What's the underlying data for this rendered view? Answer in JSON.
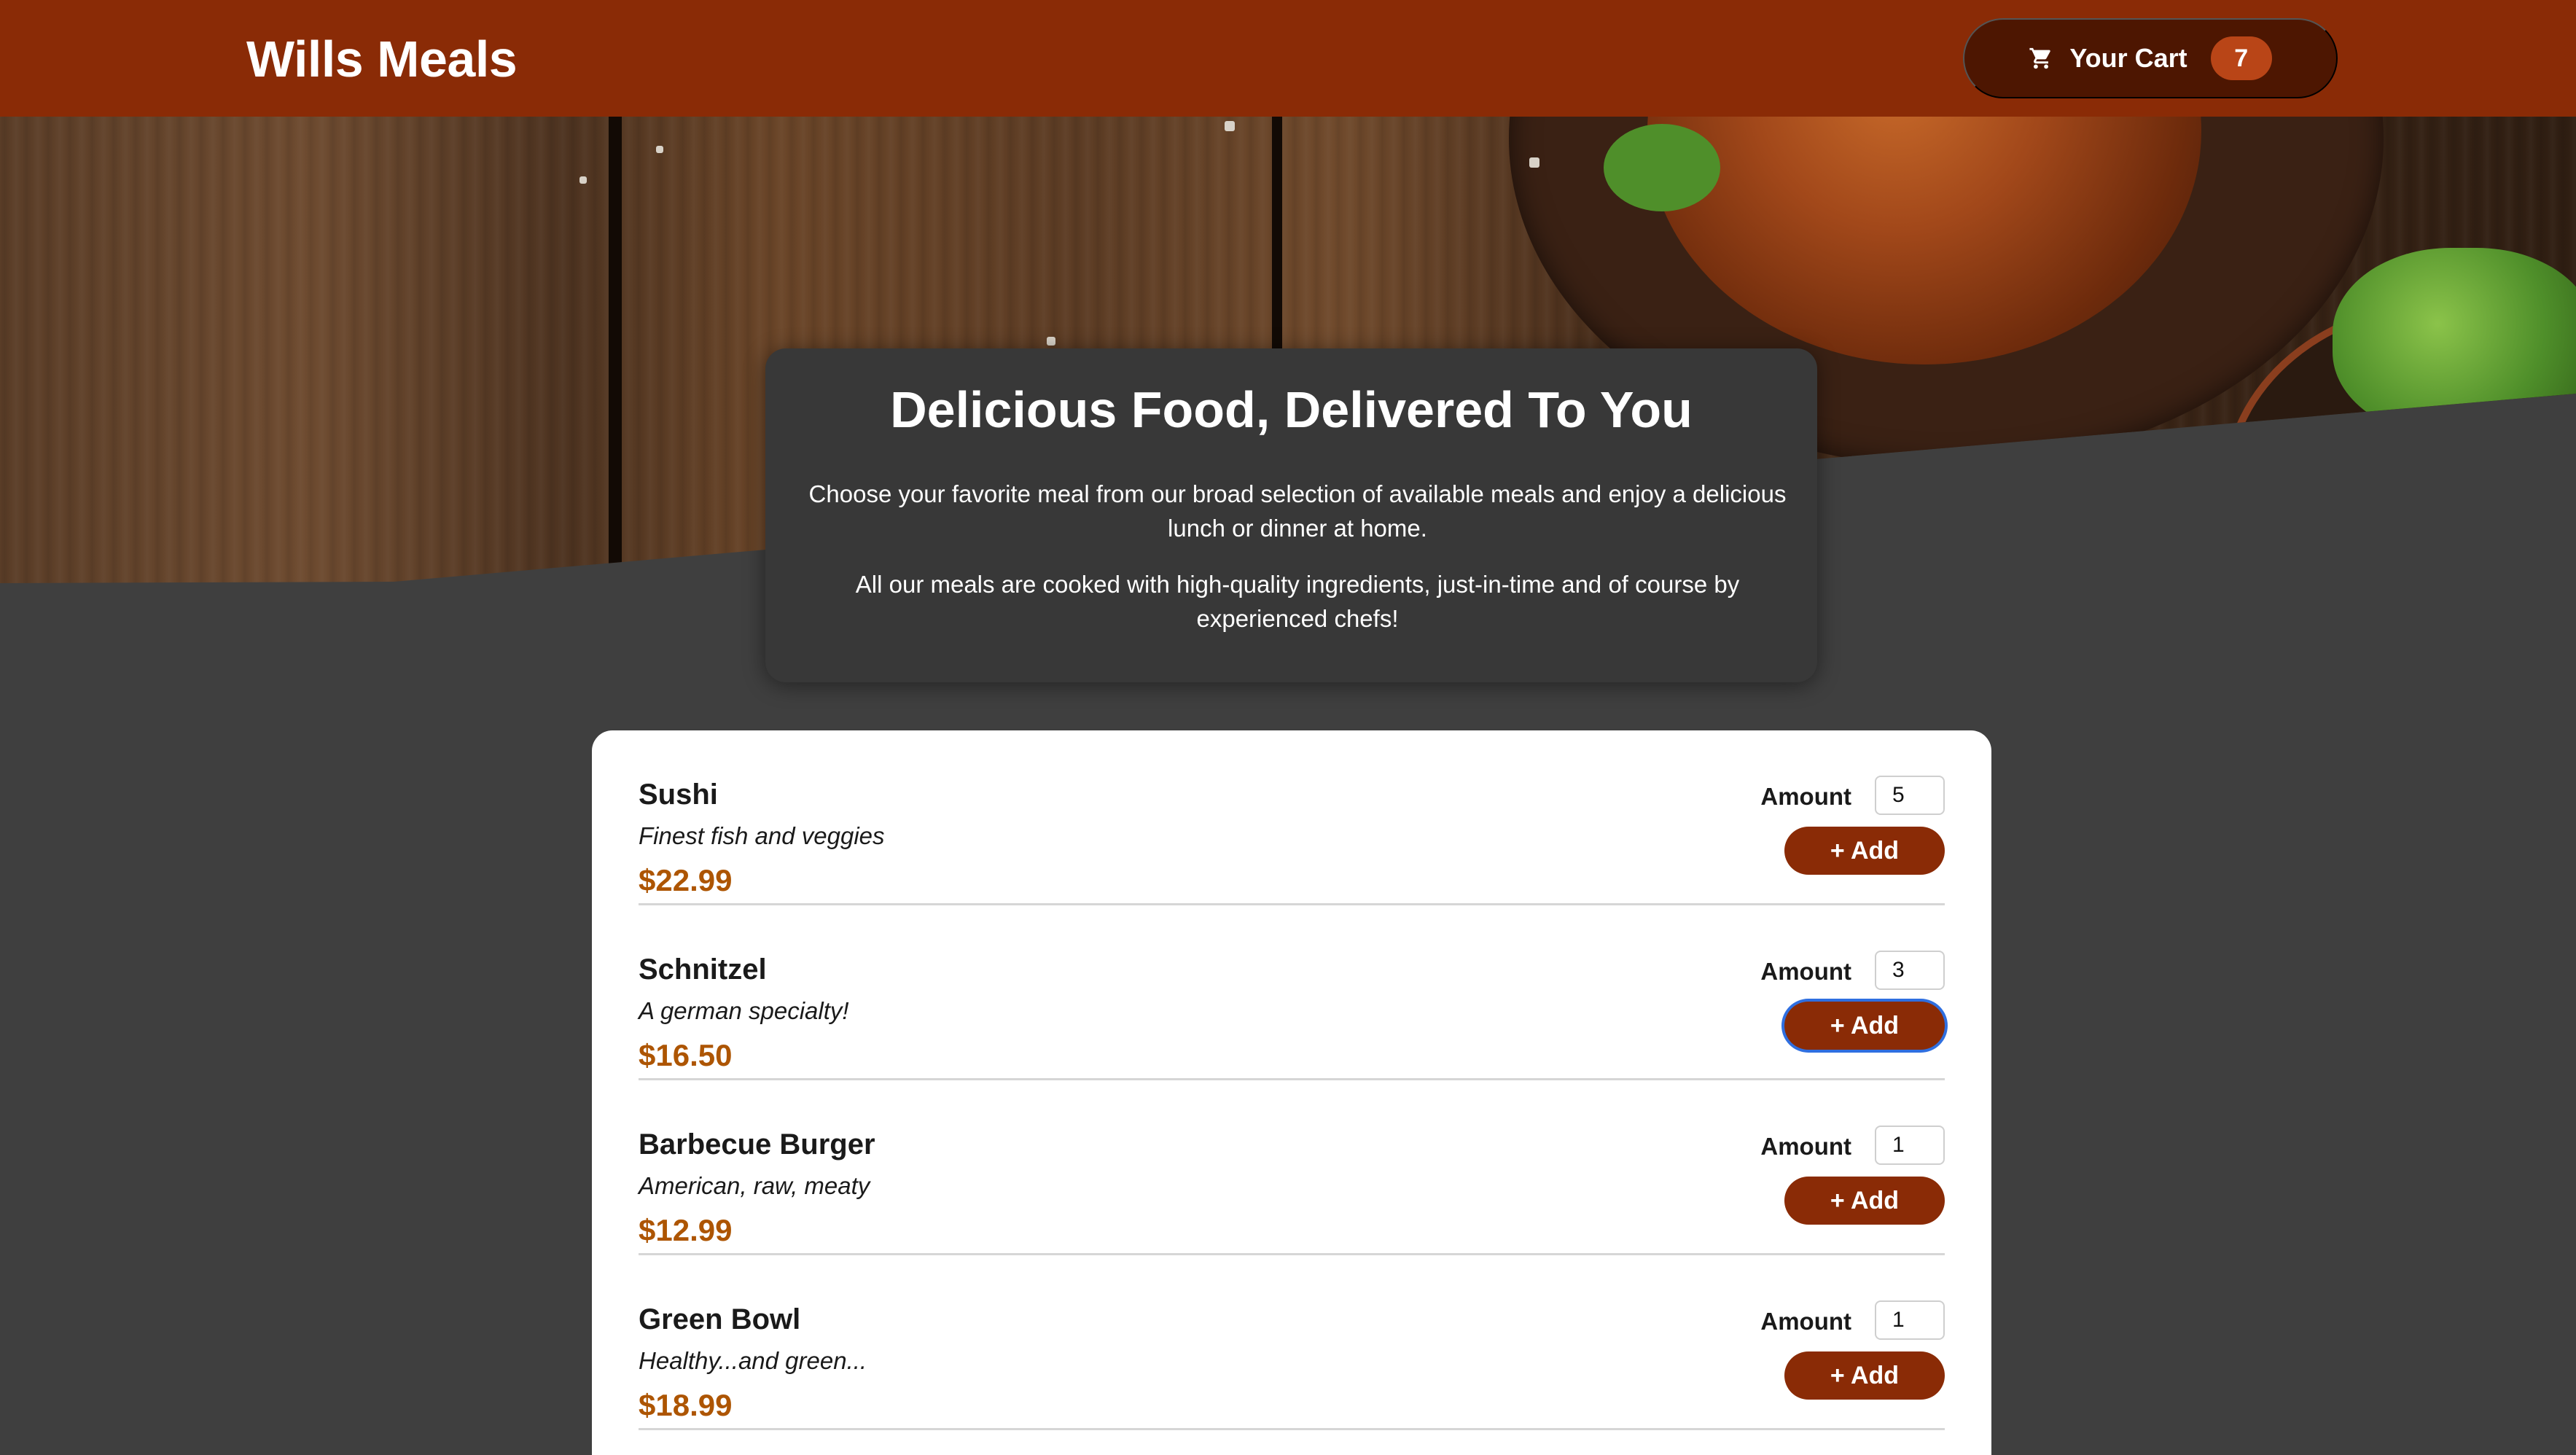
{
  "header": {
    "brand": "Wills Meals",
    "cart": {
      "icon": "shopping-cart-icon",
      "label": "Your Cart",
      "count": "7"
    }
  },
  "summary": {
    "title": "Delicious Food, Delivered To You",
    "paragraph1": "Choose your favorite meal from our broad selection of available meals and enjoy a delicious lunch or dinner at home.",
    "paragraph2": "All our meals are cooked with high-quality ingredients, just-in-time and of course by experienced chefs!"
  },
  "meals": {
    "amount_label": "Amount",
    "add_label": "+ Add",
    "items": [
      {
        "name": "Sushi",
        "description": "Finest fish and veggies",
        "price": "$22.99",
        "amount": "5"
      },
      {
        "name": "Schnitzel",
        "description": "A german specialty!",
        "price": "$16.50",
        "amount": "3"
      },
      {
        "name": "Barbecue Burger",
        "description": "American, raw, meaty",
        "price": "$12.99",
        "amount": "1"
      },
      {
        "name": "Green Bowl",
        "description": "Healthy...and green...",
        "price": "$18.99",
        "amount": "1"
      }
    ]
  },
  "colors": {
    "header_bg": "#8a2b06",
    "cart_bg": "#4d1601",
    "badge_bg": "#b94517",
    "price": "#ad5502",
    "page_bg": "#3f3f3f",
    "focus_ring": "#2f6fe0"
  }
}
